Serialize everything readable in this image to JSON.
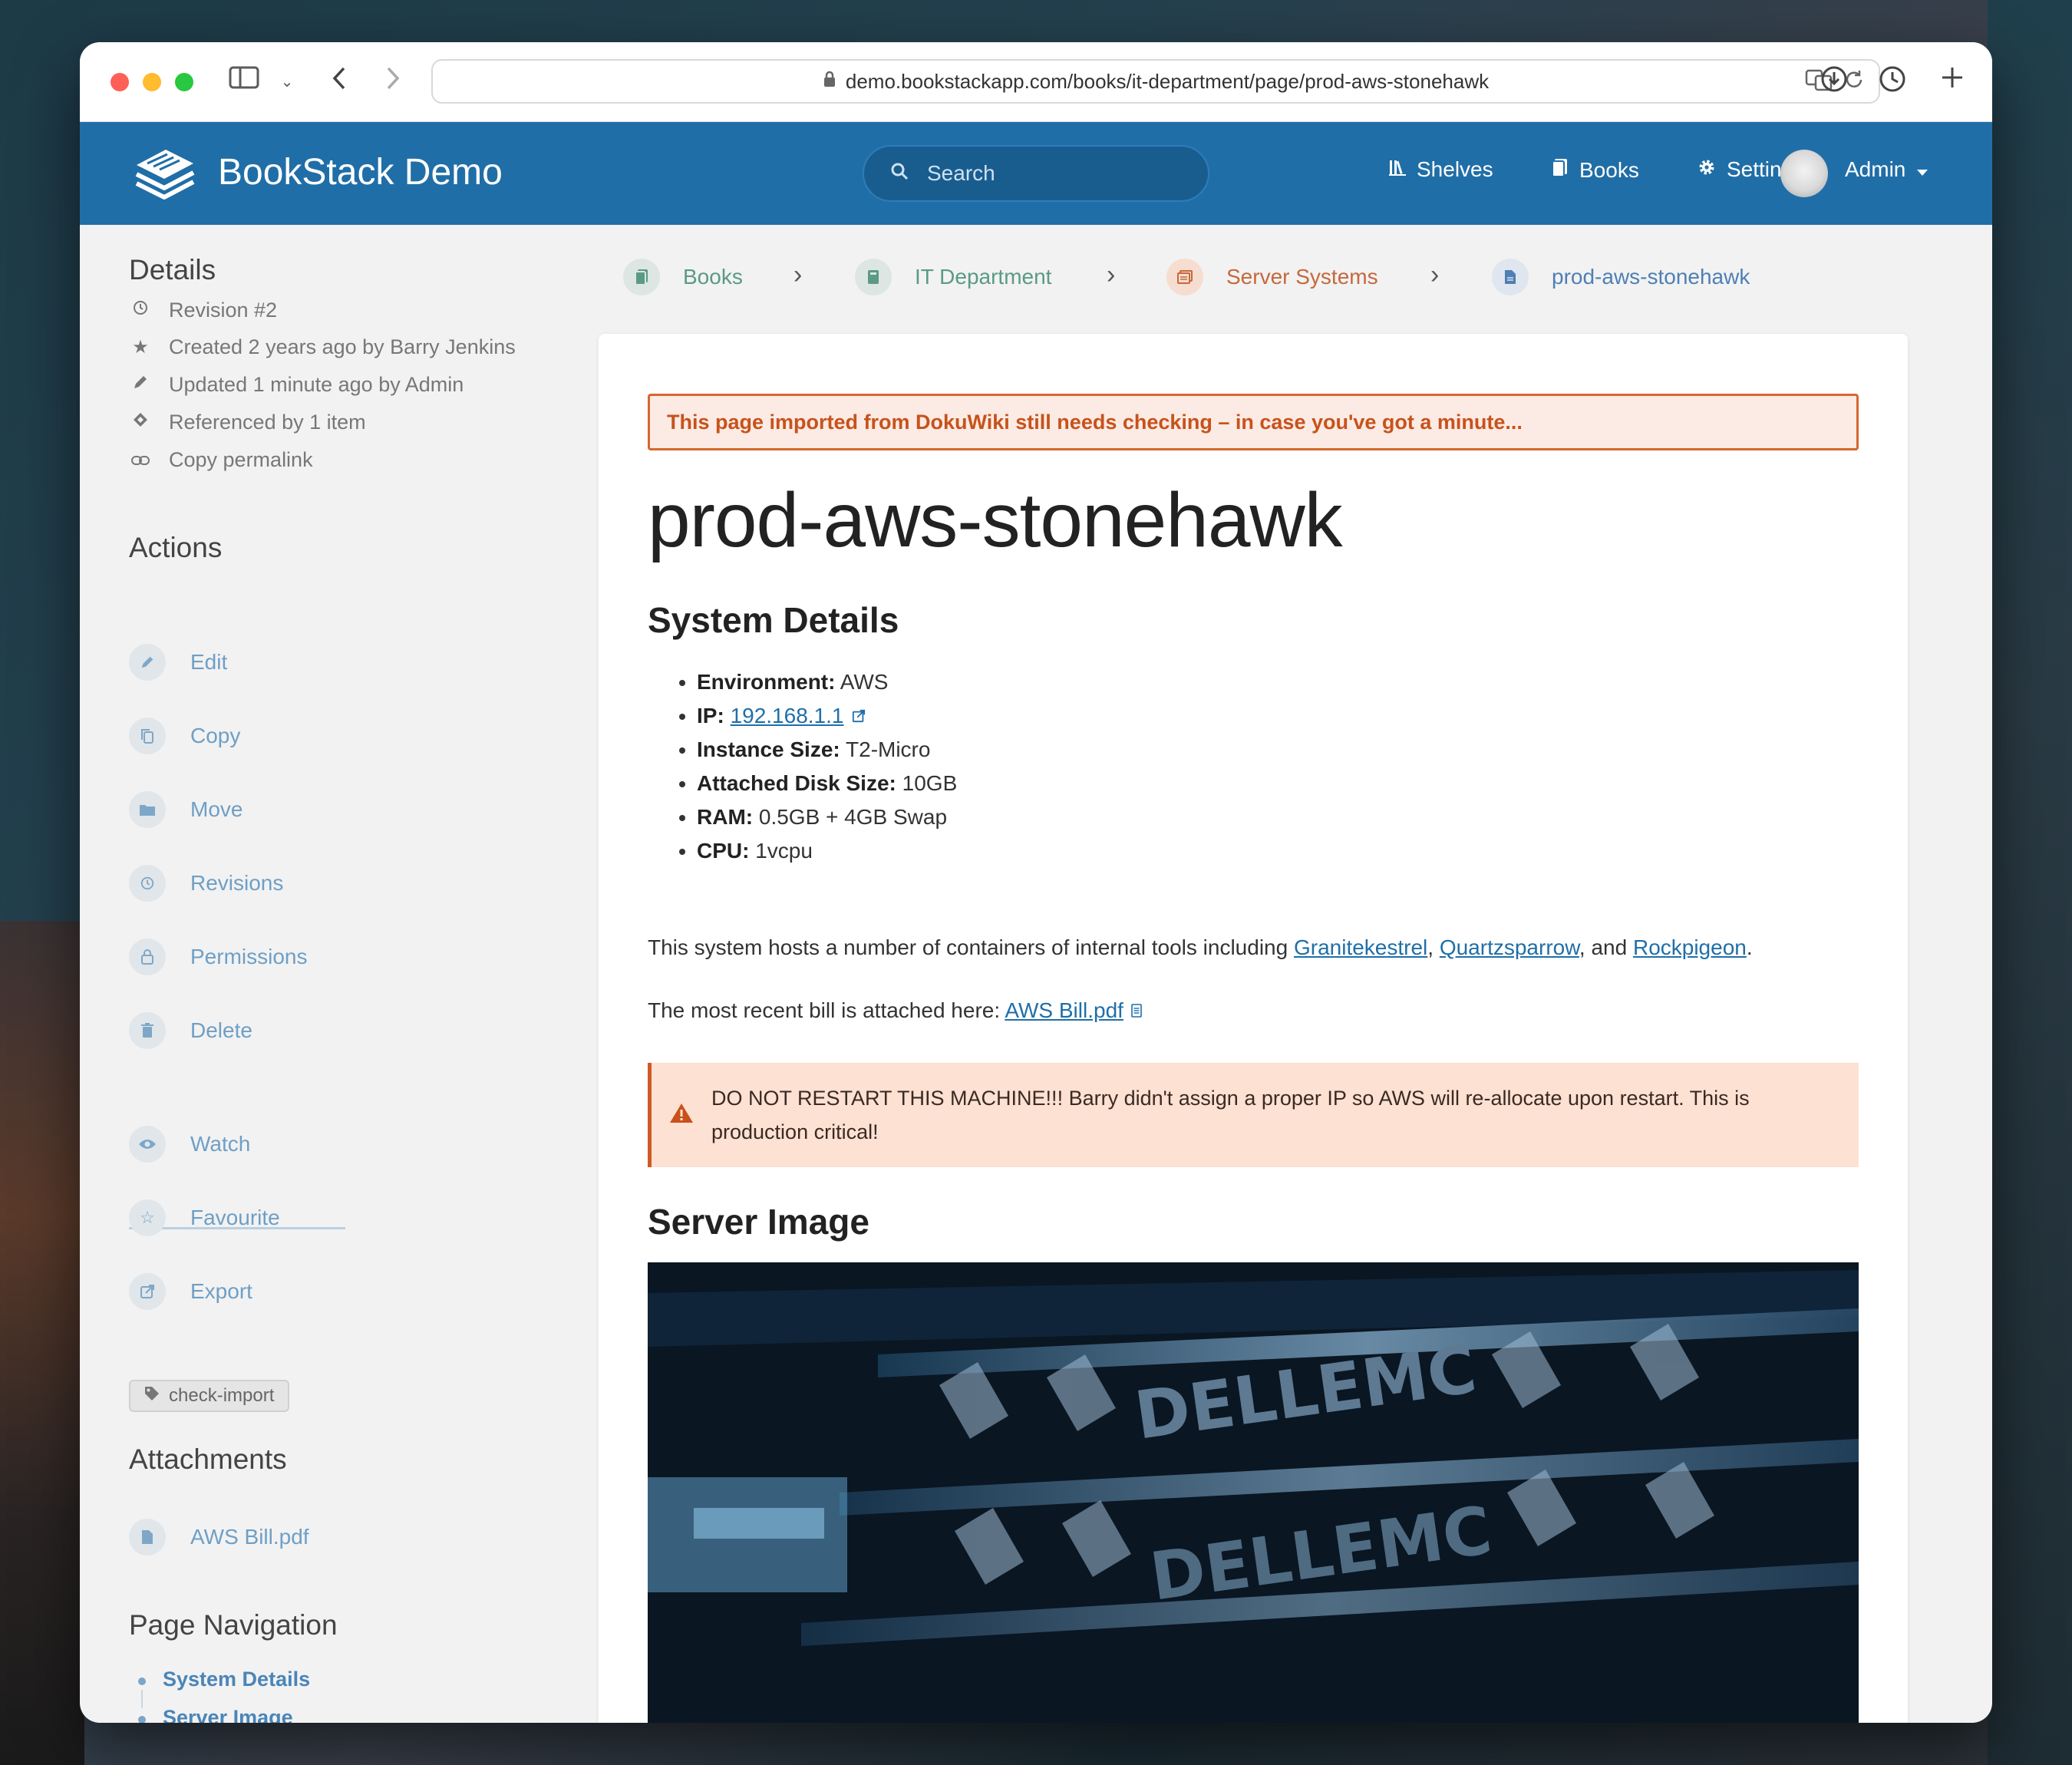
{
  "browser": {
    "url": "demo.bookstackapp.com/books/it-department/page/prod-aws-stonehawk"
  },
  "header": {
    "app_title": "BookStack Demo",
    "search_placeholder": "Search",
    "nav": {
      "shelves": "Shelves",
      "books": "Books",
      "settings": "Settings",
      "user": "Admin"
    },
    "brand_color": "#206ea7"
  },
  "sidebar": {
    "details_heading": "Details",
    "details": {
      "revision": "Revision #2",
      "created": "Created 2 years ago by Barry Jenkins",
      "updated": "Updated 1 minute ago by Admin",
      "referenced": "Referenced by 1 item",
      "permalink": "Copy permalink"
    },
    "actions_heading": "Actions",
    "actions": {
      "edit": "Edit",
      "copy": "Copy",
      "move": "Move",
      "revisions": "Revisions",
      "permissions": "Permissions",
      "delete": "Delete",
      "watch": "Watch",
      "favourite": "Favourite",
      "export": "Export"
    },
    "tag": "check-import",
    "attachments_heading": "Attachments",
    "attachment": "AWS Bill.pdf",
    "page_nav_heading": "Page Navigation",
    "page_nav": {
      "item1": "System Details",
      "item2": "Server Image"
    }
  },
  "breadcrumbs": {
    "books": "Books",
    "book": "IT Department",
    "chapter": "Server Systems",
    "page": "prod-aws-stonehawk"
  },
  "content": {
    "notice": "This page imported from DokuWiki still needs checking – in case you've got a minute...",
    "title": "prod-aws-stonehawk",
    "section1": "System Details",
    "specs": {
      "env_label": "Environment:",
      "env_value": "AWS",
      "ip_label": "IP:",
      "ip_value": "192.168.1.1",
      "size_label": "Instance Size:",
      "size_value": "T2-Micro",
      "disk_label": "Attached Disk Size:",
      "disk_value": "10GB",
      "ram_label": "RAM:",
      "ram_value": "0.5GB + 4GB Swap",
      "cpu_label": "CPU:",
      "cpu_value": "1vcpu"
    },
    "hosts_text": "This system hosts a number of containers of internal tools including ",
    "hosts_links": {
      "a": "Granitekestrel",
      "b": "Quartzsparrow",
      "c": "Rockpigeon"
    },
    "hosts_sep1": ", ",
    "hosts_sep2": ", and ",
    "hosts_end": ".",
    "bill_text": "The most recent bill is attached here: ",
    "bill_link": "AWS Bill.pdf",
    "warning": "DO NOT RESTART THIS MACHINE!!! Barry didn't assign a proper IP so AWS will re-allocate upon restart. This is production critical!",
    "section2": "Server Image",
    "image_brand_text": "DELLEMC"
  }
}
